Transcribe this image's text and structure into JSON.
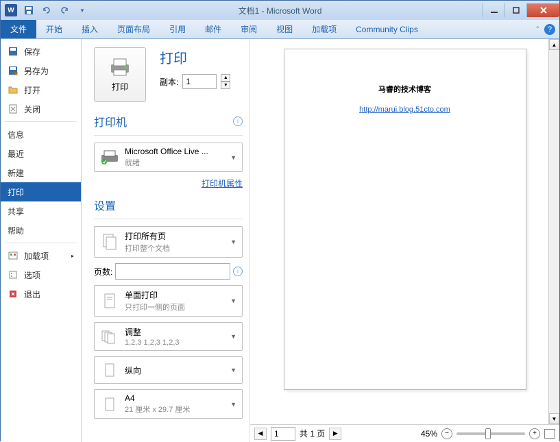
{
  "titlebar": {
    "title": "文档1 - Microsoft Word"
  },
  "ribbon": {
    "file": "文件",
    "tabs": [
      "开始",
      "插入",
      "页面布局",
      "引用",
      "邮件",
      "审阅",
      "视图",
      "加载项",
      "Community Clips"
    ]
  },
  "nav": {
    "items": [
      {
        "label": "保存",
        "icon": "save"
      },
      {
        "label": "另存为",
        "icon": "saveas"
      },
      {
        "label": "打开",
        "icon": "open"
      },
      {
        "label": "关闭",
        "icon": "close"
      }
    ],
    "sections": [
      {
        "label": "信息"
      },
      {
        "label": "最近"
      },
      {
        "label": "新建"
      },
      {
        "label": "打印",
        "selected": true
      },
      {
        "label": "共享"
      },
      {
        "label": "帮助"
      }
    ],
    "footer": [
      {
        "label": "加载项",
        "icon": "addin",
        "caret": true
      },
      {
        "label": "选项",
        "icon": "options"
      },
      {
        "label": "退出",
        "icon": "exit"
      }
    ]
  },
  "print": {
    "bigbtn": "打印",
    "heading": "打印",
    "copies_label": "副本:",
    "copies_value": "1",
    "printer_head": "打印机",
    "printer_name": "Microsoft Office Live ...",
    "printer_status": "就绪",
    "printer_props": "打印机属性",
    "settings_head": "设置",
    "range_main": "打印所有页",
    "range_sub": "打印整个文档",
    "pages_label": "页数:",
    "pages_value": "",
    "duplex_main": "单面打印",
    "duplex_sub": "只打印一侧的页面",
    "collate_main": "调整",
    "collate_sub": "1,2,3    1,2,3    1,2,3",
    "orient": "纵向",
    "paper_main": "A4",
    "paper_sub": "21 厘米 x 29.7 厘米"
  },
  "preview": {
    "doc_title": "马睿的技术博客",
    "doc_link": "http://marui.blog.51cto.com",
    "page_current": "1",
    "page_total": "共 1 页",
    "zoom": "45%"
  }
}
